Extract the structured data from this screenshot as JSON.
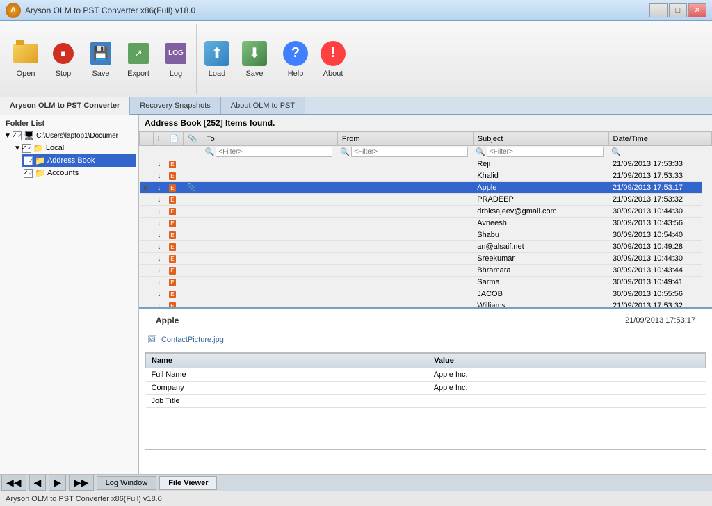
{
  "window": {
    "title": "Aryson OLM to PST Converter x86(Full) v18.0",
    "app_name": "Aryson OLM to PST Converter"
  },
  "toolbar": {
    "groups": [
      {
        "buttons": [
          {
            "id": "open",
            "label": "Open",
            "icon": "folder-open-icon"
          },
          {
            "id": "stop",
            "label": "Stop",
            "icon": "stop-icon"
          },
          {
            "id": "save",
            "label": "Save",
            "icon": "save-icon"
          },
          {
            "id": "export",
            "label": "Export",
            "icon": "export-icon"
          },
          {
            "id": "log",
            "label": "Log",
            "icon": "log-icon"
          }
        ]
      },
      {
        "buttons": [
          {
            "id": "load",
            "label": "Load",
            "icon": "load-icon"
          },
          {
            "id": "save2",
            "label": "Save",
            "icon": "save2-icon"
          }
        ]
      },
      {
        "buttons": [
          {
            "id": "help",
            "label": "Help",
            "icon": "help-icon"
          },
          {
            "id": "about",
            "label": "About",
            "icon": "about-icon"
          }
        ]
      }
    ]
  },
  "tabs": [
    {
      "label": "Aryson OLM to PST Converter",
      "active": true
    },
    {
      "label": "Recovery Snapshots",
      "active": false
    },
    {
      "label": "About OLM to PST",
      "active": false
    }
  ],
  "sidebar": {
    "header": "Folder List",
    "tree": [
      {
        "level": 0,
        "label": "C:\\Users\\laptop1\\Documer",
        "checked": true,
        "expanded": true,
        "type": "drive"
      },
      {
        "level": 1,
        "label": "Local",
        "checked": true,
        "expanded": true,
        "type": "folder"
      },
      {
        "level": 2,
        "label": "Address Book",
        "checked": true,
        "selected": true,
        "type": "folder"
      },
      {
        "level": 2,
        "label": "Accounts",
        "checked": true,
        "type": "folder"
      }
    ]
  },
  "email_list": {
    "header": "Address Book [252] Items found.",
    "columns": [
      "",
      "",
      "",
      "To",
      "From",
      "Subject",
      "Date/Time"
    ],
    "filter_placeholders": [
      "<Filter>",
      "<Filter>",
      "<Filter>"
    ],
    "rows": [
      {
        "arrow": "",
        "col1": "↓",
        "col2": "📧",
        "col3": "",
        "to": "",
        "from": "",
        "subject": "Reji",
        "datetime": "21/09/2013 17:53:33",
        "selected": false
      },
      {
        "arrow": "",
        "col1": "↓",
        "col2": "📧",
        "col3": "",
        "to": "",
        "from": "",
        "subject": "Khalid",
        "datetime": "21/09/2013 17:53:33",
        "selected": false
      },
      {
        "arrow": "▶",
        "col1": "↓",
        "col2": "📧",
        "col3": "📎",
        "to": "",
        "from": "",
        "subject": "Apple",
        "datetime": "21/09/2013 17:53:17",
        "selected": true
      },
      {
        "arrow": "",
        "col1": "↓",
        "col2": "📧",
        "col3": "",
        "to": "",
        "from": "",
        "subject": "PRADEEP",
        "datetime": "21/09/2013 17:53:32",
        "selected": false
      },
      {
        "arrow": "",
        "col1": "↓",
        "col2": "📧",
        "col3": "",
        "to": "",
        "from": "",
        "subject": "drbksajeev@gmail.com",
        "datetime": "30/09/2013 10:44:30",
        "selected": false
      },
      {
        "arrow": "",
        "col1": "↓",
        "col2": "📧",
        "col3": "",
        "to": "",
        "from": "",
        "subject": "Avneesh",
        "datetime": "30/09/2013 10:43:56",
        "selected": false
      },
      {
        "arrow": "",
        "col1": "↓",
        "col2": "📧",
        "col3": "",
        "to": "",
        "from": "",
        "subject": "Shabu",
        "datetime": "30/09/2013 10:54:40",
        "selected": false
      },
      {
        "arrow": "",
        "col1": "↓",
        "col2": "📧",
        "col3": "",
        "to": "",
        "from": "",
        "subject": "an@alsaif.net",
        "datetime": "30/09/2013 10:49:28",
        "selected": false
      },
      {
        "arrow": "",
        "col1": "↓",
        "col2": "📧",
        "col3": "",
        "to": "",
        "from": "",
        "subject": "Sreekumar",
        "datetime": "30/09/2013 10:44:30",
        "selected": false
      },
      {
        "arrow": "",
        "col1": "↓",
        "col2": "📧",
        "col3": "",
        "to": "",
        "from": "",
        "subject": "Bhramara",
        "datetime": "30/09/2013 10:43:44",
        "selected": false
      },
      {
        "arrow": "",
        "col1": "↓",
        "col2": "📧",
        "col3": "",
        "to": "",
        "from": "",
        "subject": "Sarma",
        "datetime": "30/09/2013 10:49:41",
        "selected": false
      },
      {
        "arrow": "",
        "col1": "↓",
        "col2": "📧",
        "col3": "",
        "to": "",
        "from": "",
        "subject": "JACOB",
        "datetime": "30/09/2013 10:55:56",
        "selected": false
      },
      {
        "arrow": "",
        "col1": "↓",
        "col2": "📧",
        "col3": "",
        "to": "",
        "from": "",
        "subject": "Williams",
        "datetime": "21/09/2013 17:53:32",
        "selected": false
      }
    ]
  },
  "preview": {
    "sender": "Apple",
    "date": "21/09/2013 17:53:17",
    "attachment": "ContactPicture.jpg",
    "contact_fields": [
      {
        "name": "Full Name",
        "value": "Apple Inc."
      },
      {
        "name": "Company",
        "value": "Apple Inc."
      },
      {
        "name": "Job Title",
        "value": ""
      }
    ]
  },
  "bottom_tabs": {
    "nav_buttons": [
      "◀◀",
      "◀",
      "▶",
      "▶▶"
    ],
    "tabs": [
      {
        "label": "Log Window",
        "active": false
      },
      {
        "label": "File Viewer",
        "active": true
      }
    ]
  },
  "status_bar": {
    "text": "Aryson OLM to PST Converter x86(Full) v18.0"
  }
}
